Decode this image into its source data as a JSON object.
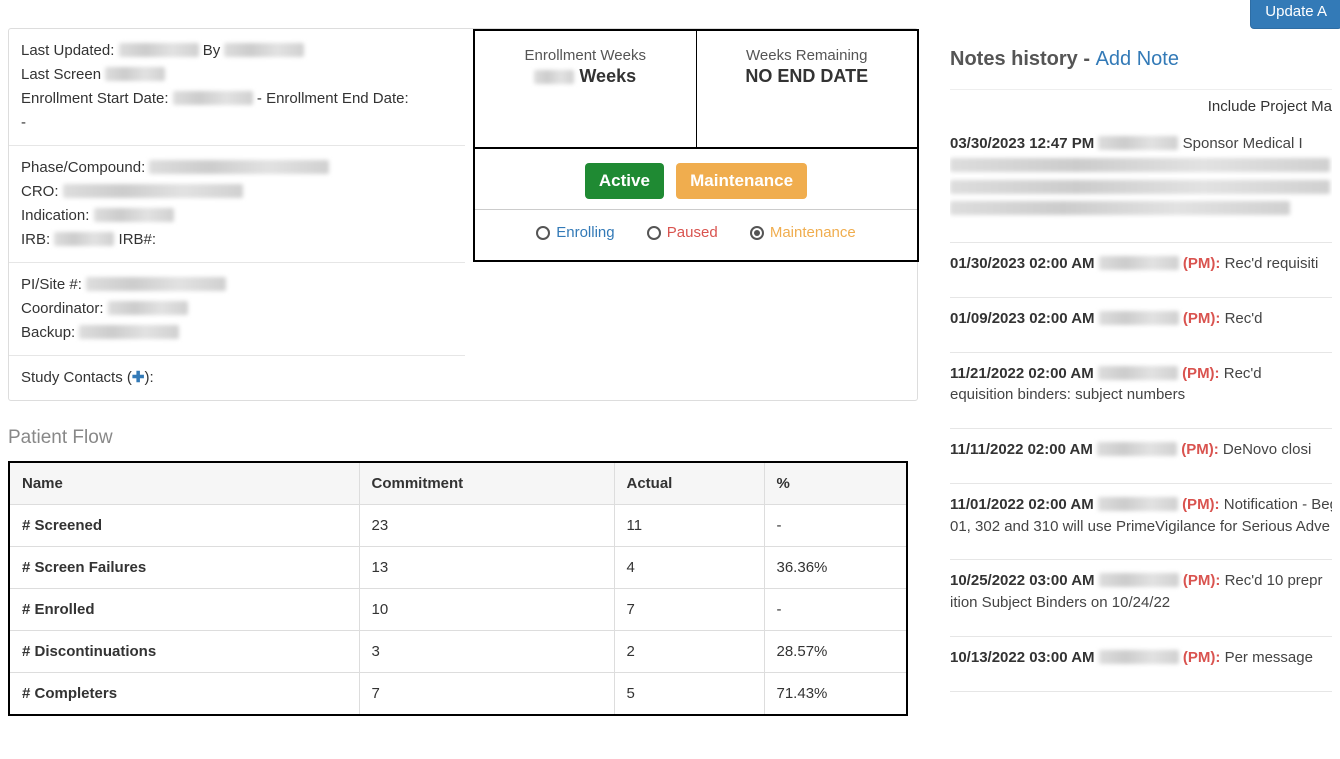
{
  "buttons": {
    "update": "Update A"
  },
  "info": {
    "last_updated_label": "Last Updated:",
    "by_label": "By",
    "last_screen_label": "Last Screen",
    "enroll_start_label": "Enrollment Start Date:",
    "enroll_end_label": " - Enrollment End Date:",
    "dash": "-",
    "phase_label": "Phase/Compound:",
    "cro_label": "CRO:",
    "indication_label": "Indication:",
    "irb_label": "IRB:",
    "irb_num_label": " IRB#:",
    "pi_label": "PI/Site #:",
    "coord_label": "Coordinator:",
    "backup_label": "Backup:",
    "contacts_label": "Study Contacts ("
  },
  "status": {
    "enroll_weeks_label": "Enrollment Weeks",
    "enroll_weeks_value": "Weeks",
    "remain_label": "Weeks Remaining",
    "remain_value": "NO END DATE",
    "badge_active": "Active",
    "badge_maint": "Maintenance",
    "opt_enrolling": "Enrolling",
    "opt_paused": "Paused",
    "opt_maintenance": "Maintenance"
  },
  "patient_flow_title": "Patient Flow",
  "pf_headers": {
    "name": "Name",
    "commit": "Commitment",
    "actual": "Actual",
    "pct": "%"
  },
  "pf_rows": [
    {
      "name": "# Screened",
      "commit": "23",
      "actual": "11",
      "pct": "-"
    },
    {
      "name": "# Screen Failures",
      "commit": "13",
      "actual": "4",
      "pct": "36.36%"
    },
    {
      "name": "# Enrolled",
      "commit": "10",
      "actual": "7",
      "pct": "-"
    },
    {
      "name": "# Discontinuations",
      "commit": "3",
      "actual": "2",
      "pct": "28.57%"
    },
    {
      "name": "# Completers",
      "commit": "7",
      "actual": "5",
      "pct": "71.43%"
    }
  ],
  "notes_header": "Notes history - ",
  "add_note": "Add Note",
  "include_pm": "Include Project Ma",
  "notes": [
    {
      "ts": "03/30/2023 12:47 PM",
      "pm": "",
      "text": "Sponsor Medical I"
    },
    {
      "ts": "01/30/2023 02:00 AM",
      "pm": "(PM):",
      "text": "Rec'd requisiti"
    },
    {
      "ts": "01/09/2023 02:00 AM",
      "pm": "(PM):",
      "text": "Rec'd "
    },
    {
      "ts": "11/21/2022 02:00 AM",
      "pm": "(PM):",
      "text": "Rec'd ",
      "line2": "equisition binders: subject numbers"
    },
    {
      "ts": "11/11/2022 02:00 AM",
      "pm": "(PM):",
      "text": "DeNovo closi"
    },
    {
      "ts": "11/01/2022 02:00 AM",
      "pm": "(PM):",
      "text": "Notification - Beg",
      "line2": "01, 302 and 310 will use PrimeVigilance for Serious Adve"
    },
    {
      "ts": "10/25/2022 03:00 AM",
      "pm": "(PM):",
      "text": "Rec'd 10 prepr",
      "line2": "ition Subject Binders on 10/24/22"
    },
    {
      "ts": "10/13/2022 03:00 AM",
      "pm": "(PM):",
      "text": "Per message "
    }
  ]
}
